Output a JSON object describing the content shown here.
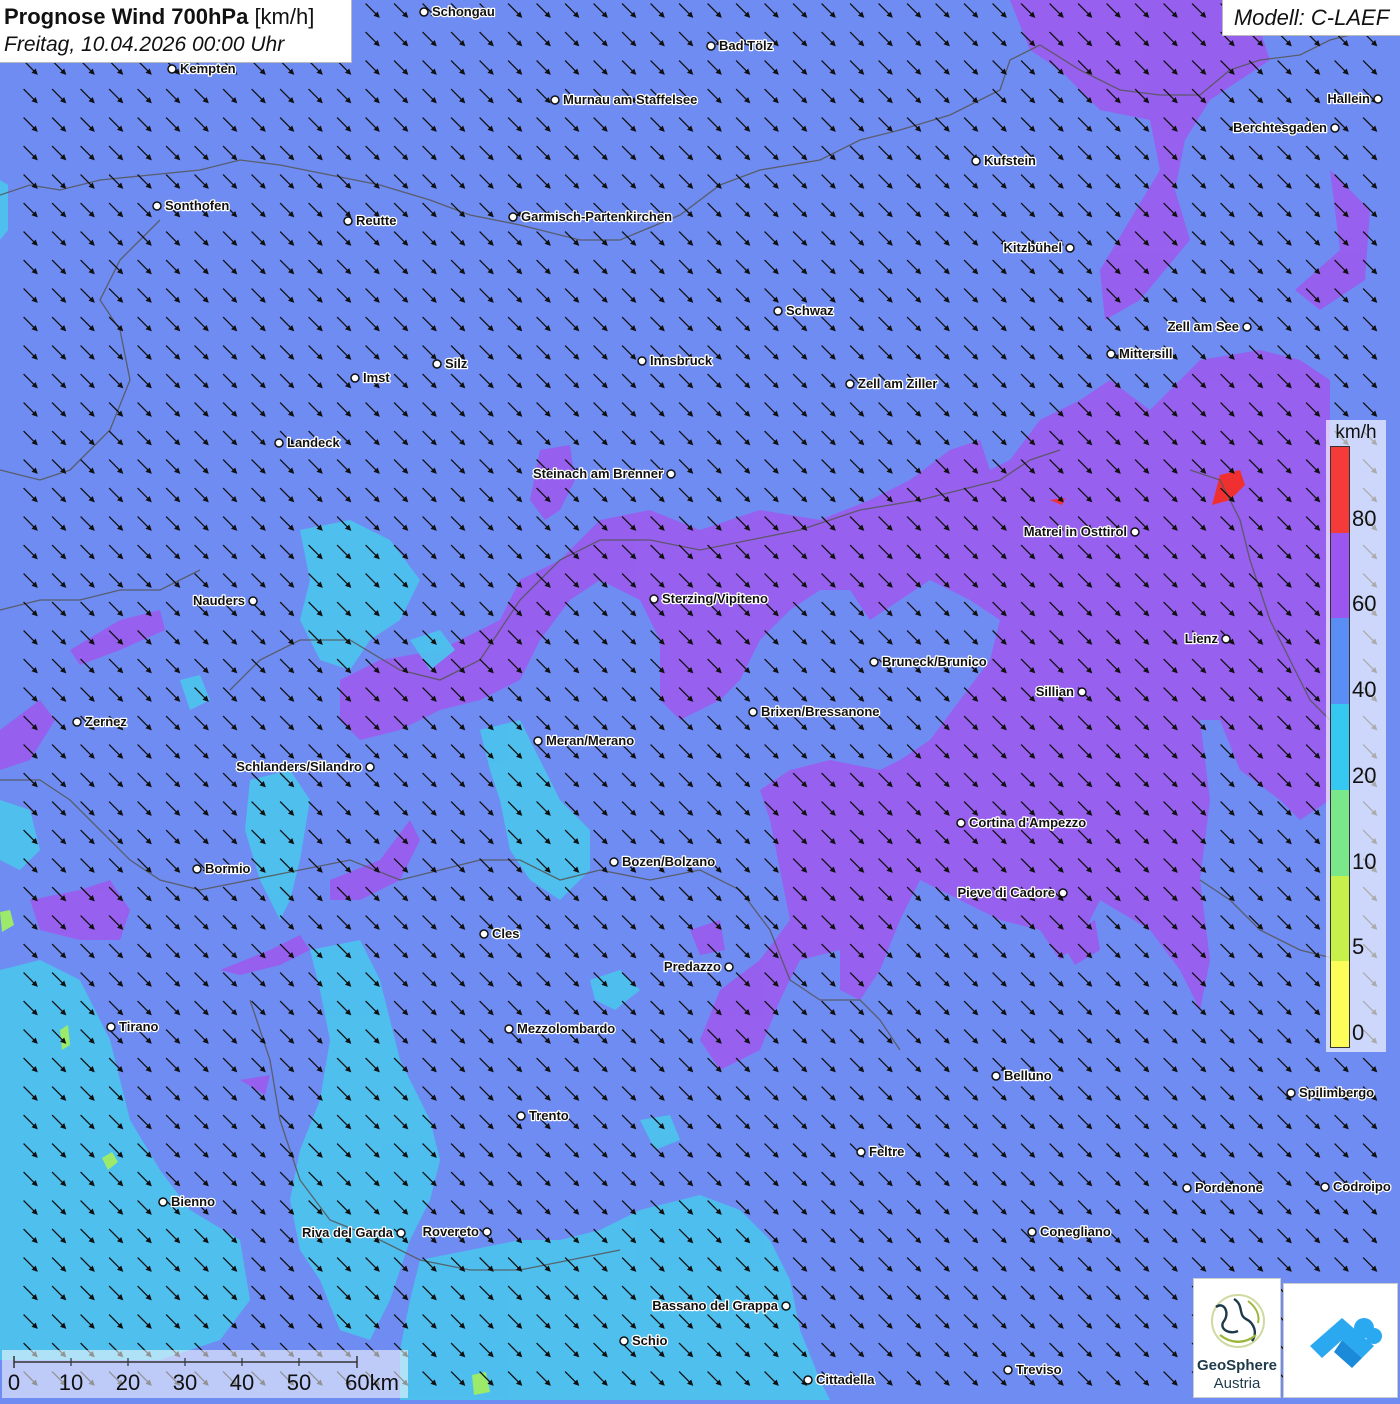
{
  "header": {
    "title_bold": "Prognose Wind 700hPa",
    "title_unit": "[km/h]",
    "subtitle": "Freitag, 10.04.2026 00:00 Uhr",
    "model": "Modell: C-LAEF"
  },
  "legend": {
    "unit": "km/h",
    "classes": [
      {
        "label": "0",
        "color": "#fdfd5a"
      },
      {
        "label": "5",
        "color": "#c8f04a"
      },
      {
        "label": "10",
        "color": "#7ae88a"
      },
      {
        "label": "20",
        "color": "#35c8f0"
      },
      {
        "label": "40",
        "color": "#5a8ef5"
      },
      {
        "label": "60",
        "color": "#9b55f0"
      },
      {
        "label": "80",
        "color": "#f53a3a"
      }
    ]
  },
  "scale_bar": {
    "labels": [
      "0",
      "10",
      "20",
      "30",
      "40",
      "50",
      "60km"
    ]
  },
  "colors": {
    "base_field": "#6f8cf2",
    "purple_field": "#9a5cee",
    "cyan_field": "#4cc3ee",
    "red_field": "#f03030",
    "arrow": "#111111",
    "border": "#555555"
  },
  "wind": {
    "direction_deg": 135,
    "description": "north-westerly flow (arrows point south-east)"
  },
  "cities": [
    "Schongau",
    "Bad Tölz",
    "Kempten",
    "Murnau am Staffelsee",
    "Hallein",
    "Berchtesgaden",
    "Kufstein",
    "Sonthofen",
    "Reutte",
    "Garmisch-Partenkirchen",
    "Kitzbühel",
    "Schwaz",
    "Zell am See",
    "Mittersill",
    "Innsbruck",
    "Silz",
    "Imst",
    "Zell am Ziller",
    "Landeck",
    "Steinach am Brenner",
    "Matrei in Osttirol",
    "Nauders",
    "Sterzing/Vipiteno",
    "Lienz",
    "Bruneck/Brunico",
    "Sillian",
    "Zernez",
    "Brixen/Bressanone",
    "Meran/Merano",
    "Schlanders/Silandro",
    "Cortina d'Ampezzo",
    "Bozen/Bolzano",
    "Bormio",
    "Pieve di Cadore",
    "Cles",
    "Predazzo",
    "Tirano",
    "Mezzolombardo",
    "Belluno",
    "Spilimbergo",
    "Trento",
    "Feltre",
    "Bienno",
    "Pordenone",
    "Codroipo",
    "Riva del Garda",
    "Rovereto",
    "Conegliano",
    "Bassano del Grappa",
    "Schio",
    "Treviso",
    "Cittadella"
  ],
  "logos": {
    "geosphere_name": "GeoSphere",
    "geosphere_sub": "Austria"
  }
}
